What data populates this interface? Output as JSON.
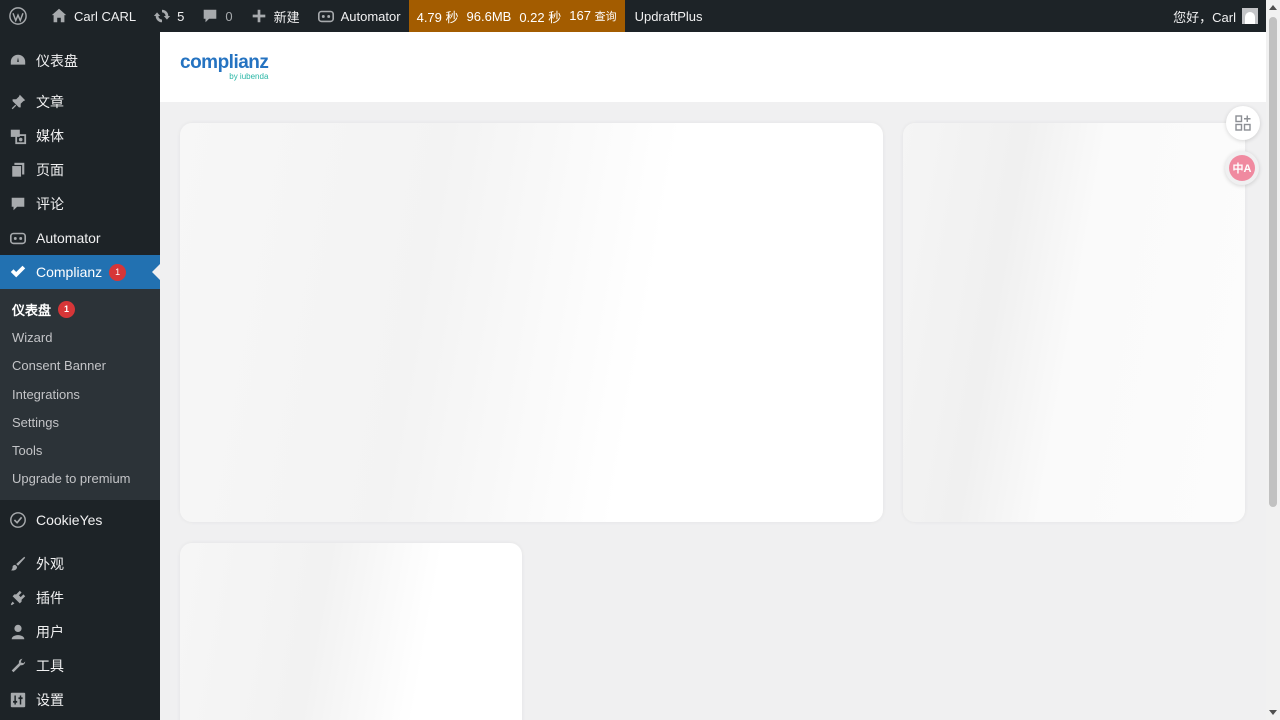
{
  "adminbar": {
    "site_name": "Carl CARL",
    "updates_count": "5",
    "comments_count": "0",
    "new_label": "新建",
    "automator_label": "Automator",
    "perf": {
      "time": "4.79 秒",
      "memory": "96.6MB",
      "db_time": "0.22 秒",
      "queries": "167",
      "queries_label": "查询"
    },
    "updraft_label": "UpdraftPlus",
    "greeting": "您好，Carl"
  },
  "sidebar": {
    "items": [
      {
        "label": "仪表盘",
        "icon": "dashboard-icon"
      },
      {
        "label": "文章",
        "icon": "pin-icon"
      },
      {
        "label": "媒体",
        "icon": "media-icon"
      },
      {
        "label": "页面",
        "icon": "page-icon"
      },
      {
        "label": "评论",
        "icon": "comment-icon"
      },
      {
        "label": "Automator",
        "icon": "automator-icon"
      },
      {
        "label": "Complianz",
        "icon": "checkmark-icon",
        "badge": "1"
      },
      {
        "label": "CookieYes",
        "icon": "cookie-icon"
      },
      {
        "label": "外观",
        "icon": "brush-icon"
      },
      {
        "label": "插件",
        "icon": "plugin-icon"
      },
      {
        "label": "用户",
        "icon": "user-icon"
      },
      {
        "label": "工具",
        "icon": "wrench-icon"
      },
      {
        "label": "设置",
        "icon": "settings-icon"
      }
    ],
    "submenu": [
      {
        "label": "仪表盘",
        "badge": "1"
      },
      {
        "label": "Wizard"
      },
      {
        "label": "Consent Banner"
      },
      {
        "label": "Integrations"
      },
      {
        "label": "Settings"
      },
      {
        "label": "Tools"
      },
      {
        "label": "Upgrade to premium"
      }
    ]
  },
  "header": {
    "logo_text": "complianz",
    "logo_sub": "by iubenda"
  },
  "float_tools": {
    "translate_glyph": "中A"
  },
  "colors": {
    "admin_dark": "#1d2327",
    "accent_blue": "#2271b1",
    "badge_red": "#d63638",
    "perf_orange": "#a35c00",
    "logo_blue": "#2573c1",
    "logo_teal": "#29b6a5"
  }
}
